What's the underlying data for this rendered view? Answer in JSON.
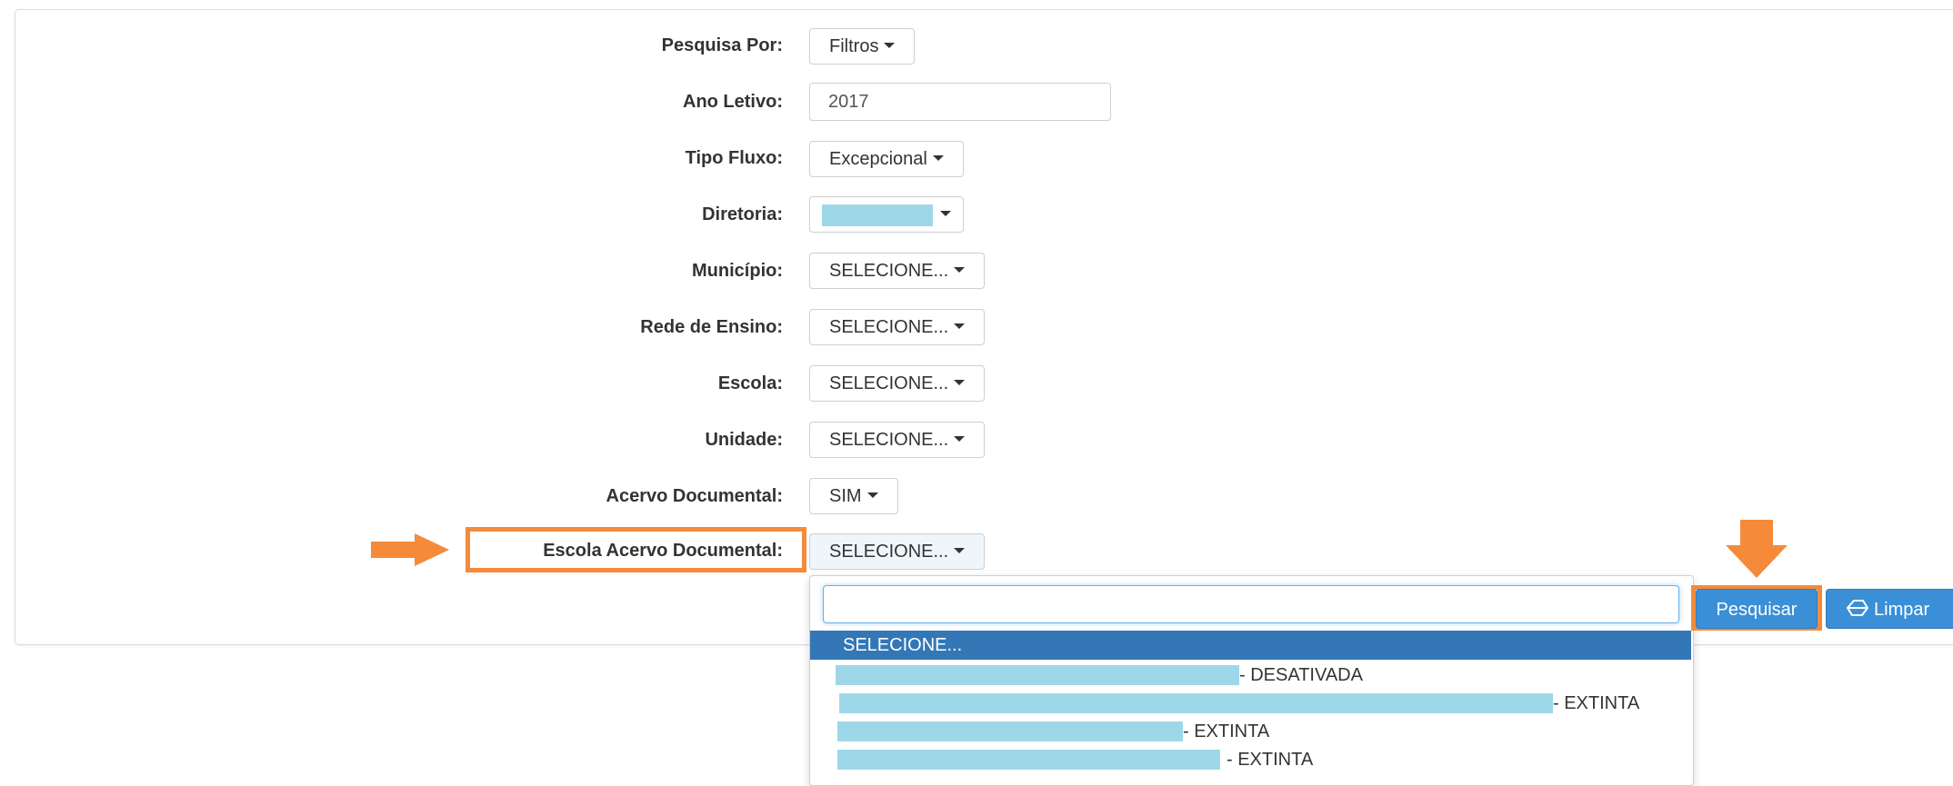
{
  "form": {
    "pesquisa_por": {
      "label": "Pesquisa Por:",
      "value": "Filtros"
    },
    "ano_letivo": {
      "label": "Ano Letivo:",
      "value": "2017"
    },
    "tipo_fluxo": {
      "label": "Tipo Fluxo:",
      "value": "Excepcional"
    },
    "diretoria": {
      "label": "Diretoria:",
      "value": ""
    },
    "municipio": {
      "label": "Município:",
      "value": "SELECIONE..."
    },
    "rede_ensino": {
      "label": "Rede de Ensino:",
      "value": "SELECIONE..."
    },
    "escola": {
      "label": "Escola:",
      "value": "SELECIONE..."
    },
    "unidade": {
      "label": "Unidade:",
      "value": "SELECIONE..."
    },
    "acervo_documental": {
      "label": "Acervo Documental:",
      "value": "SIM"
    },
    "escola_acervo": {
      "label": "Escola Acervo Documental:",
      "value": "SELECIONE..."
    }
  },
  "dropdown": {
    "search_value": "",
    "selected": "SELECIONE...",
    "items": [
      {
        "suffix": "- DESATIVADA"
      },
      {
        "suffix": "- EXTINTA"
      },
      {
        "suffix": "- EXTINTA"
      },
      {
        "suffix": "- EXTINTA"
      }
    ]
  },
  "actions": {
    "search_label": "Pesquisar",
    "clear_label": "Limpar"
  },
  "colors": {
    "accent": "#f58a3a",
    "primary": "#3a8fd6",
    "selected_bg": "#3377b7",
    "redaction": "#9ed8e8"
  },
  "icons": {
    "clear": "eraser-icon",
    "annotation": "arrow-icon"
  }
}
